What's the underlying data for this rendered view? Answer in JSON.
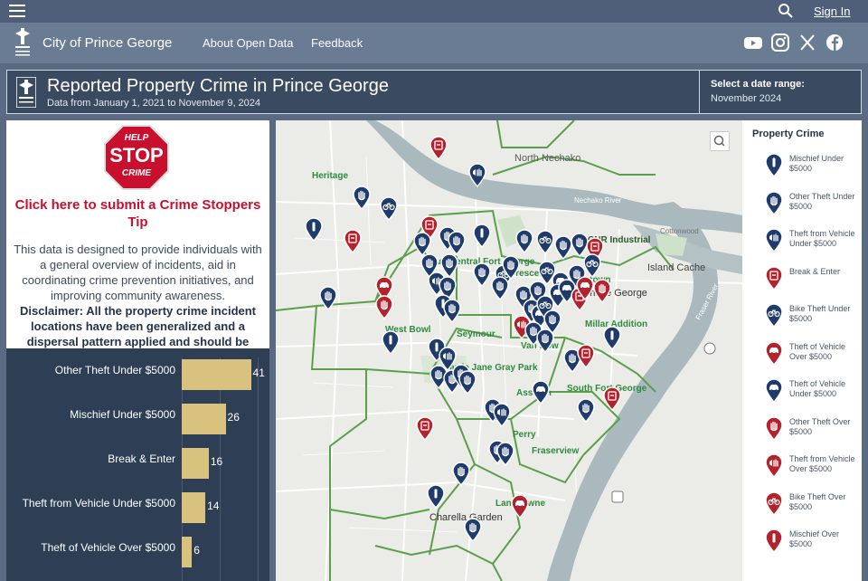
{
  "topbar": {
    "menu_icon": "hamburger-menu-icon",
    "search_icon": "search-icon",
    "signin_label": "Sign In"
  },
  "nav": {
    "city_name": "City of Prince George",
    "links": [
      "About Open Data",
      "Feedback"
    ],
    "social_icons": [
      "youtube-icon",
      "instagram-icon",
      "x-icon",
      "facebook-icon"
    ]
  },
  "header": {
    "title": "Reported Property Crime in Prince George",
    "subtitle": "Data from January 1, 2021 to November 9, 2024",
    "date_range_label": "Select a date range:",
    "date_range_value": "November 2024"
  },
  "crime_stoppers": {
    "sign_line1": "HELP",
    "sign_line2": "STOP",
    "sign_line3": "CRIME",
    "link_text": "Click here to submit a Crime Stoppers Tip",
    "description": "This data is designed to provide individuals with a general overview of incidents, aid in coordinating crime prevention initiatives, and improving community awareness.",
    "disclaimer": "Disclaimer:  All the property crime incident locations have been generalized and a dispersal pattern applied and should be"
  },
  "chart_data": {
    "type": "bar",
    "orientation": "horizontal",
    "categories": [
      "Other Theft Under $5000",
      "Mischief Under $5000",
      "Break & Enter",
      "Theft from Vehicle Under $5000",
      "Theft of Vehicle Over $5000"
    ],
    "values": [
      41,
      26,
      16,
      14,
      6
    ],
    "xlim": [
      0,
      45
    ],
    "grid": true
  },
  "map": {
    "labels": {
      "north_nechako": "North Nechako",
      "heritage": "Heritage",
      "nechako_river": "Nechako River",
      "cottonwood": "Cottonwood",
      "cnr_industrial": "CNR Industrial",
      "east_central_fort_george": "East Central Fort George",
      "crescents": "Crescents",
      "island_cache": "Island Cache",
      "downtown": "Downtown",
      "prince_george": "Prince George",
      "fraser_river": "Fraser River",
      "west_bowl": "West Bowl",
      "seymour": "Seymour",
      "millar_addition": "Millar Addition",
      "van_bow": "Van Bow",
      "carrie_jane_gray_park": "Carrie Jane Gray Park",
      "south_fort_george": "South Fort George",
      "assman": "Assman",
      "perry": "Perry",
      "fraserview": "Fraserview",
      "lansdowne": "Lansdowne",
      "charella_garden": "Charella Garden"
    },
    "search_icon": "map-search-icon"
  },
  "legend": {
    "title": "Property Crime",
    "items": [
      {
        "label": "Mischief Under $5000",
        "color": "#1f3b6b",
        "icon": "mischief-icon"
      },
      {
        "label": "Other Theft Under $5000",
        "color": "#1f3b6b",
        "icon": "hand-icon"
      },
      {
        "label": "Theft from Vehicle Under $5000",
        "color": "#1f3b6b",
        "icon": "vehicle-hand-icon"
      },
      {
        "label": "Break & Enter",
        "color": "#b3232e",
        "icon": "break-enter-icon"
      },
      {
        "label": "Bike Theft Under $5000",
        "color": "#1f3b6b",
        "icon": "bike-icon"
      },
      {
        "label": "Theft of Vehicle Over $5000",
        "color": "#b3232e",
        "icon": "car-icon"
      },
      {
        "label": "Theft of Vehicle Under $5000",
        "color": "#1f3b6b",
        "icon": "car-icon"
      },
      {
        "label": "Other Theft Over $5000",
        "color": "#b3232e",
        "icon": "hand-icon"
      },
      {
        "label": "Theft from Vehicle Over $5000",
        "color": "#b3232e",
        "icon": "vehicle-hand-icon"
      },
      {
        "label": "Bike Theft Over $5000",
        "color": "#b3232e",
        "icon": "bike-icon"
      },
      {
        "label": "Mischief Over $5000",
        "color": "#b3232e",
        "icon": "mischief-icon"
      }
    ]
  },
  "colors": {
    "blue_pin": "#1f3b6b",
    "red_pin": "#b3232e",
    "bar": "#d8c27e",
    "chart_bg": "#2e3e55"
  }
}
